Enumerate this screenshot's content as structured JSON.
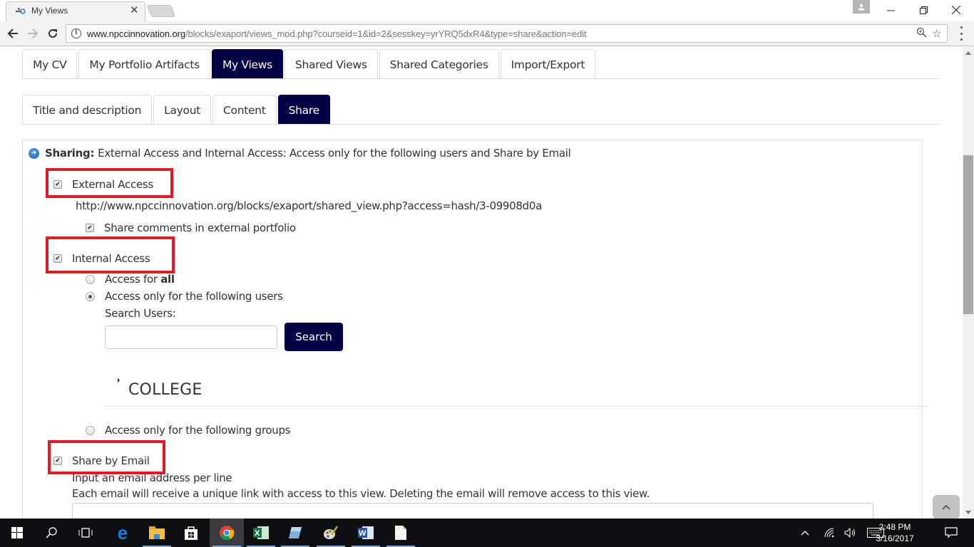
{
  "browser": {
    "tab_title": "My Views",
    "url_host": "www.npccinnovation.org",
    "url_path": "/blocks/exaport/views_mod.php?courseid=1&id=2&sesskey=yrYRQ5dxR4&type=share&action=edit",
    "icons": {
      "back": "arrow-left-icon",
      "forward": "arrow-right-icon",
      "reload": "reload-icon",
      "info": "info-icon",
      "zoom": "zoom-icon",
      "bookmark": "star-icon",
      "menu": "more-vert-icon"
    }
  },
  "nav": {
    "main_tabs": [
      {
        "label": "My CV",
        "active": false
      },
      {
        "label": "My Portfolio Artifacts",
        "active": false
      },
      {
        "label": "My Views",
        "active": true
      },
      {
        "label": "Shared Views",
        "active": false
      },
      {
        "label": "Shared Categories",
        "active": false
      },
      {
        "label": "Import/Export",
        "active": false
      }
    ],
    "sub_tabs": [
      {
        "label": "Title and description",
        "active": false
      },
      {
        "label": "Layout",
        "active": false
      },
      {
        "label": "Content",
        "active": false
      },
      {
        "label": "Share",
        "active": true
      }
    ]
  },
  "share": {
    "summary_label": "Sharing:",
    "summary_text": "External Access and Internal Access: Access only for the following users and Share by Email",
    "external_access": {
      "label": "External Access",
      "checked": true
    },
    "external_url": "http://www.npccinnovation.org/blocks/exaport/shared_view.php?access=hash/3-09908d0a",
    "share_comments": {
      "label": "Share comments in external portfolio",
      "checked": true
    },
    "internal_access": {
      "label": "Internal Access",
      "checked": true
    },
    "access_all": {
      "label_prefix": "Access for ",
      "label_bold": "all",
      "selected": false
    },
    "access_users": {
      "label": "Access only for the following users",
      "selected": true
    },
    "search_users_label": "Search Users:",
    "search_input_value": "",
    "search_button": "Search",
    "group_heading": "COLLEGE",
    "access_groups": {
      "label": "Access only for the following groups",
      "selected": false
    },
    "share_email": {
      "label": "Share by Email",
      "checked": true
    },
    "email_hint1": "Input an email address per line",
    "email_hint2": "Each email will receive a unique link with access to this view. Deleting the email will remove access to this view.",
    "email_value": ""
  },
  "highlight_color": "#e01b24",
  "accent_color": "#020245",
  "taskbar": {
    "time": "2:48 PM",
    "date": "3/16/2017",
    "apps": [
      "start-icon",
      "search-icon",
      "task-view-icon",
      "edge-icon",
      "file-explorer-icon",
      "store-icon",
      "chrome-icon",
      "excel-icon",
      "notepad-icon",
      "paint-icon",
      "word-icon",
      "document-icon"
    ]
  }
}
